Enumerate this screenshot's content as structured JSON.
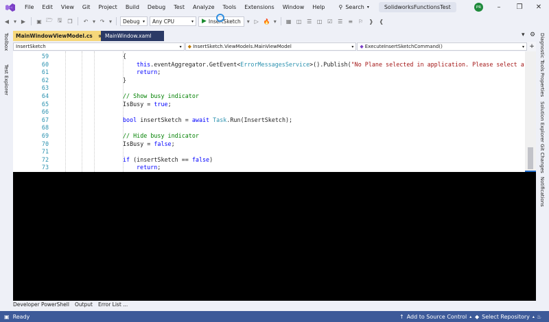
{
  "menu": [
    "File",
    "Edit",
    "View",
    "Git",
    "Project",
    "Build",
    "Debug",
    "Test",
    "Analyze",
    "Tools",
    "Extensions",
    "Window",
    "Help"
  ],
  "search": {
    "label": "Search"
  },
  "solution_name": "SolidworksFunctionsTest",
  "user_initials": "PR",
  "toolbar": {
    "config": "Debug",
    "platform": "Any CPU",
    "run_label": "InsertSketch"
  },
  "tabs": {
    "active": "MainWindowViewModel.cs",
    "inactive": "MainWindow.xaml"
  },
  "navbar": {
    "scope": "InsertSketch",
    "type": "InsertSketch.ViewModels.MainViewModel",
    "member": "ExecuteInsertSketchCommand()"
  },
  "left_rail": [
    "Toolbox",
    "Test Explorer"
  ],
  "right_rail": [
    "Diagnostic Tools",
    "Properties",
    "Solution Explorer",
    "Git Changes",
    "Notifications"
  ],
  "code_lines": [
    {
      "n": "59",
      "indent": 1,
      "parts": [
        {
          "t": "{",
          "c": ""
        }
      ]
    },
    {
      "n": "60",
      "indent": 2,
      "parts": [
        {
          "t": "this",
          "c": "kw"
        },
        {
          "t": ".eventAggregator.GetEvent<",
          "c": ""
        },
        {
          "t": "ErrorMessagesService",
          "c": "ty"
        },
        {
          "t": ">().Publish(",
          "c": ""
        },
        {
          "t": "\"No Plane selected in application. Please select a",
          "c": "st"
        }
      ]
    },
    {
      "n": "61",
      "indent": 2,
      "parts": [
        {
          "t": "return",
          "c": "kw"
        },
        {
          "t": ";",
          "c": ""
        }
      ]
    },
    {
      "n": "62",
      "indent": 1,
      "parts": [
        {
          "t": "}",
          "c": ""
        }
      ]
    },
    {
      "n": "63",
      "indent": 0,
      "parts": []
    },
    {
      "n": "64",
      "indent": 1,
      "parts": [
        {
          "t": "// Show busy indicator",
          "c": "cm"
        }
      ]
    },
    {
      "n": "65",
      "indent": 1,
      "parts": [
        {
          "t": "IsBusy = ",
          "c": ""
        },
        {
          "t": "true",
          "c": "kw"
        },
        {
          "t": ";",
          "c": ""
        }
      ]
    },
    {
      "n": "66",
      "indent": 0,
      "parts": []
    },
    {
      "n": "67",
      "indent": 1,
      "parts": [
        {
          "t": "bool",
          "c": "kw"
        },
        {
          "t": " insertSketch = ",
          "c": ""
        },
        {
          "t": "await",
          "c": "kw"
        },
        {
          "t": " ",
          "c": ""
        },
        {
          "t": "Task",
          "c": "ty"
        },
        {
          "t": ".Run(InsertSketch);",
          "c": ""
        }
      ]
    },
    {
      "n": "68",
      "indent": 0,
      "parts": []
    },
    {
      "n": "69",
      "indent": 1,
      "parts": [
        {
          "t": "// Hide busy indicator",
          "c": "cm"
        }
      ]
    },
    {
      "n": "70",
      "indent": 1,
      "parts": [
        {
          "t": "IsBusy = ",
          "c": ""
        },
        {
          "t": "false",
          "c": "kw"
        },
        {
          "t": ";",
          "c": ""
        }
      ]
    },
    {
      "n": "71",
      "indent": 0,
      "parts": []
    },
    {
      "n": "72",
      "indent": 1,
      "parts": [
        {
          "t": "if",
          "c": "kw"
        },
        {
          "t": " (insertSketch == ",
          "c": ""
        },
        {
          "t": "false",
          "c": "kw"
        },
        {
          "t": ")",
          "c": ""
        }
      ]
    },
    {
      "n": "73",
      "indent": 2,
      "parts": [
        {
          "t": "return",
          "c": "kw"
        },
        {
          "t": ";",
          "c": ""
        }
      ]
    }
  ],
  "tool_tabs": [
    "Developer PowerShell",
    "Output",
    "Error List ..."
  ],
  "status": {
    "state": "Ready",
    "source_control": "Add to Source Control",
    "repository": "Select Repository"
  },
  "colors": {
    "status_bar": "#3d5a99",
    "active_tab": "#f6d77a",
    "inactive_tab": "#2b3a66",
    "terminal_bg": "#000000",
    "run_green": "#1a8a2e"
  }
}
